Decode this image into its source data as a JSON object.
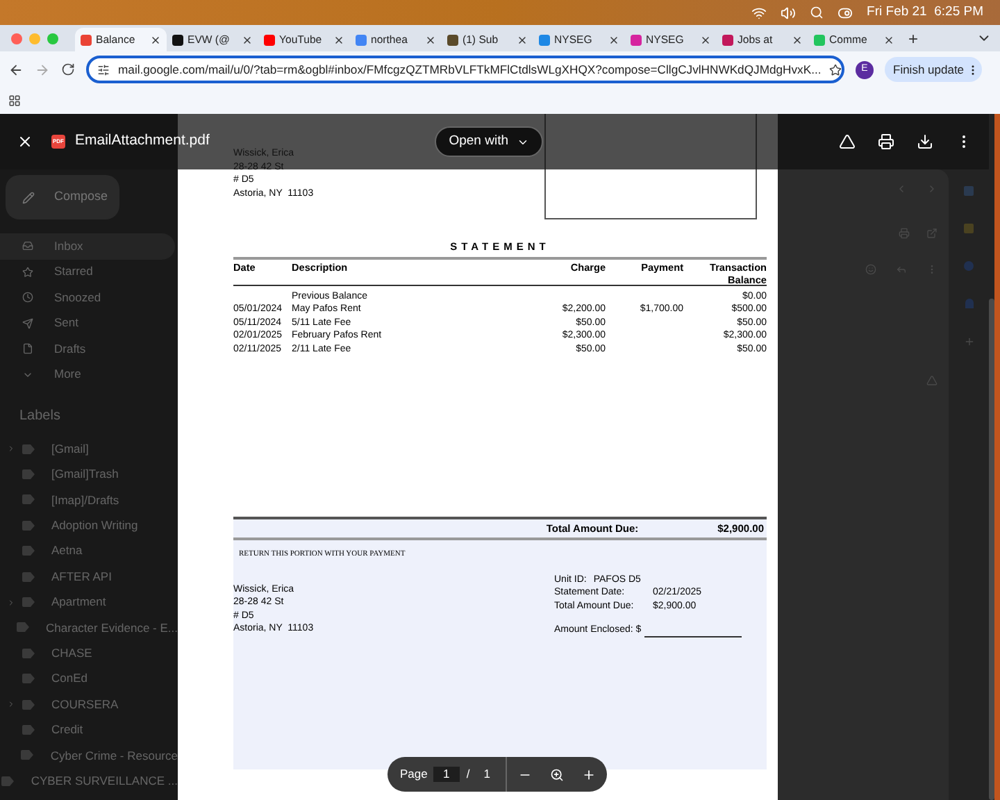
{
  "menu_bar": {
    "clock": "Fri Feb 21  6:25 PM"
  },
  "browser": {
    "tabs": [
      {
        "title": "Balance",
        "selected": true,
        "color": "#ea4335"
      },
      {
        "title": "EVW (@",
        "selected": false,
        "color": "#111111"
      },
      {
        "title": "YouTube",
        "selected": false,
        "color": "#ff0000"
      },
      {
        "title": "northea",
        "selected": false,
        "color": "#4285f4"
      },
      {
        "title": "(1) Sub",
        "selected": false,
        "color": "#5a4a2a"
      },
      {
        "title": "NYSEG",
        "selected": false,
        "color": "#1e88e5"
      },
      {
        "title": "NYSEG",
        "selected": false,
        "color": "#d6249f"
      },
      {
        "title": "Jobs at",
        "selected": false,
        "color": "#c2185b"
      },
      {
        "title": "Comme",
        "selected": false,
        "color": "#22c55e"
      }
    ],
    "new_tab": "+",
    "url": "mail.google.com/mail/u/0/?tab=rm&ogbl#inbox/FMfcgzQZTMRbVLFTkMFlCtdlsWLgXHQX?compose=CllgCJvlHNWKdQJMdgHvxK...",
    "avatar": "E",
    "update_button": "Finish update"
  },
  "gmail": {
    "compose": "Compose",
    "nav": [
      {
        "kind": "inbox",
        "label": "Inbox",
        "selected": true
      },
      {
        "kind": "starred",
        "label": "Starred",
        "selected": false
      },
      {
        "kind": "snoozed",
        "label": "Snoozed",
        "selected": false
      },
      {
        "kind": "sent",
        "label": "Sent",
        "selected": false
      },
      {
        "kind": "drafts",
        "label": "Drafts",
        "selected": false
      },
      {
        "kind": "more",
        "label": "More",
        "selected": false
      }
    ],
    "labels_heading": "Labels",
    "labels": [
      {
        "name": "[Gmail]",
        "expandable": true
      },
      {
        "name": "[Gmail]Trash",
        "expandable": false
      },
      {
        "name": "[Imap]/Drafts",
        "expandable": false
      },
      {
        "name": "Adoption Writing",
        "expandable": false
      },
      {
        "name": "Aetna",
        "expandable": false
      },
      {
        "name": "AFTER API",
        "expandable": false
      },
      {
        "name": "Apartment",
        "expandable": true
      },
      {
        "name": "Character Evidence - E...",
        "expandable": false
      },
      {
        "name": "CHASE",
        "expandable": false
      },
      {
        "name": "ConEd",
        "expandable": false
      },
      {
        "name": "COURSERA",
        "expandable": true
      },
      {
        "name": "Credit",
        "expandable": false
      },
      {
        "name": "Cyber Crime - Resource",
        "expandable": false
      },
      {
        "name": "CYBER SURVEILLANCE ...",
        "expandable": false
      }
    ]
  },
  "viewer": {
    "file_badge": "PDF",
    "file_name": "EmailAttachment.pdf",
    "open_with": "Open with",
    "page_label": "Page",
    "page_input": "1",
    "page_separator": "/",
    "page_total": "1"
  },
  "document": {
    "address": [
      "Wissick, Erica",
      "28-28 42 St",
      "# D5",
      "Astoria, NY  11103"
    ],
    "title": "STATEMENT",
    "columns": [
      "Date",
      "Description",
      "Charge",
      "Payment",
      "Transaction Balance"
    ],
    "rows": [
      {
        "description": "Previous Balance",
        "balance": "$0.00"
      },
      {
        "date": "05/01/2024",
        "description": "May Pafos Rent",
        "charge": "$2,200.00",
        "payment": "$1,700.00",
        "balance": "$500.00"
      },
      {
        "date": "05/11/2024",
        "description": "5/11 Late Fee",
        "charge": "$50.00",
        "balance": "$50.00"
      },
      {
        "date": "02/01/2025",
        "description": "February Pafos Rent",
        "charge": "$2,300.00",
        "balance": "$2,300.00"
      },
      {
        "date": "02/11/2025",
        "description": "2/11 Late Fee",
        "charge": "$50.00",
        "balance": "$50.00"
      }
    ],
    "total_label": "Total Amount Due:",
    "total": "$2,900.00",
    "return_note": "RETURN THIS PORTION WITH YOUR PAYMENT",
    "remit_address": [
      "Wissick, Erica",
      "28-28 42 St",
      "# D5",
      "Astoria, NY  11103"
    ],
    "unit_label": "Unit ID:",
    "unit": "PAFOS D5",
    "fields": [
      {
        "label": "Statement Date:",
        "value": "02/21/2025"
      },
      {
        "label": "Total Amount Due:",
        "value": "$2,900.00"
      }
    ],
    "enclosed_label": "Amount Enclosed: $"
  }
}
